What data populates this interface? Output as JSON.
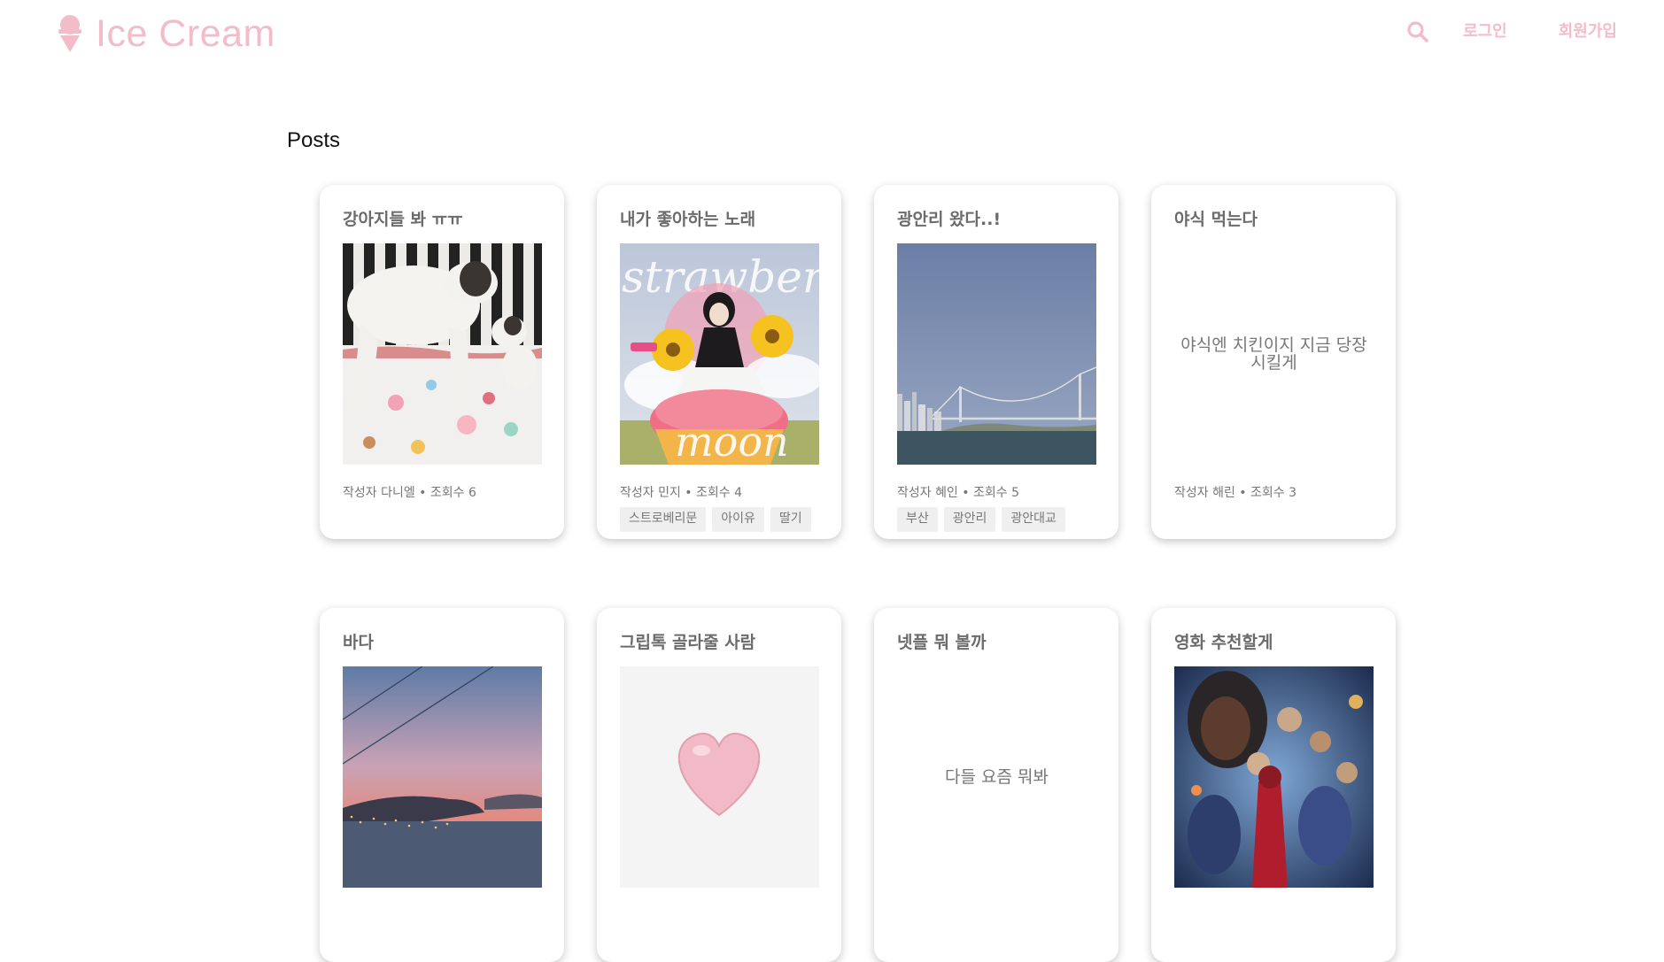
{
  "brand": {
    "name": "Ice Cream",
    "icon": "ice-cream-icon",
    "accent_color": "#f2bcc9"
  },
  "nav": {
    "search_icon": "search-icon",
    "login": "로그인",
    "signup": "회원가입"
  },
  "section": {
    "title": "Posts"
  },
  "posts": [
    {
      "title": "강아지들 봐 ㅠㅠ",
      "image": "two-puppies-photo",
      "meta": "작성자 다니엘 • 조회수 6",
      "tags": []
    },
    {
      "title": "내가 좋아하는 노래",
      "image": "strawberry-moon-album-cover",
      "meta": "작성자 민지 • 조회수 4",
      "tags": [
        "스트로베리문",
        "아이유",
        "딸기"
      ]
    },
    {
      "title": "광안리 왔다..!",
      "image": "gwangan-bridge-photo",
      "meta": "작성자 혜인 • 조회수 5",
      "tags": [
        "부산",
        "광안리",
        "광안대교"
      ]
    },
    {
      "title": "야식 먹는다",
      "body": "야식엔 치킨이지 지금 당장 시킬게",
      "meta": "작성자 해린 • 조회수 3",
      "tags": []
    },
    {
      "title": "바다",
      "image": "sunset-sea-photo"
    },
    {
      "title": "그립톡 골라줄 사람",
      "image": "pink-heart-griptok-photo"
    },
    {
      "title": "넷플 뭐 볼까",
      "body": "다들 요즘 뭐봐"
    },
    {
      "title": "영화 추천할게",
      "image": "movie-poster"
    }
  ]
}
